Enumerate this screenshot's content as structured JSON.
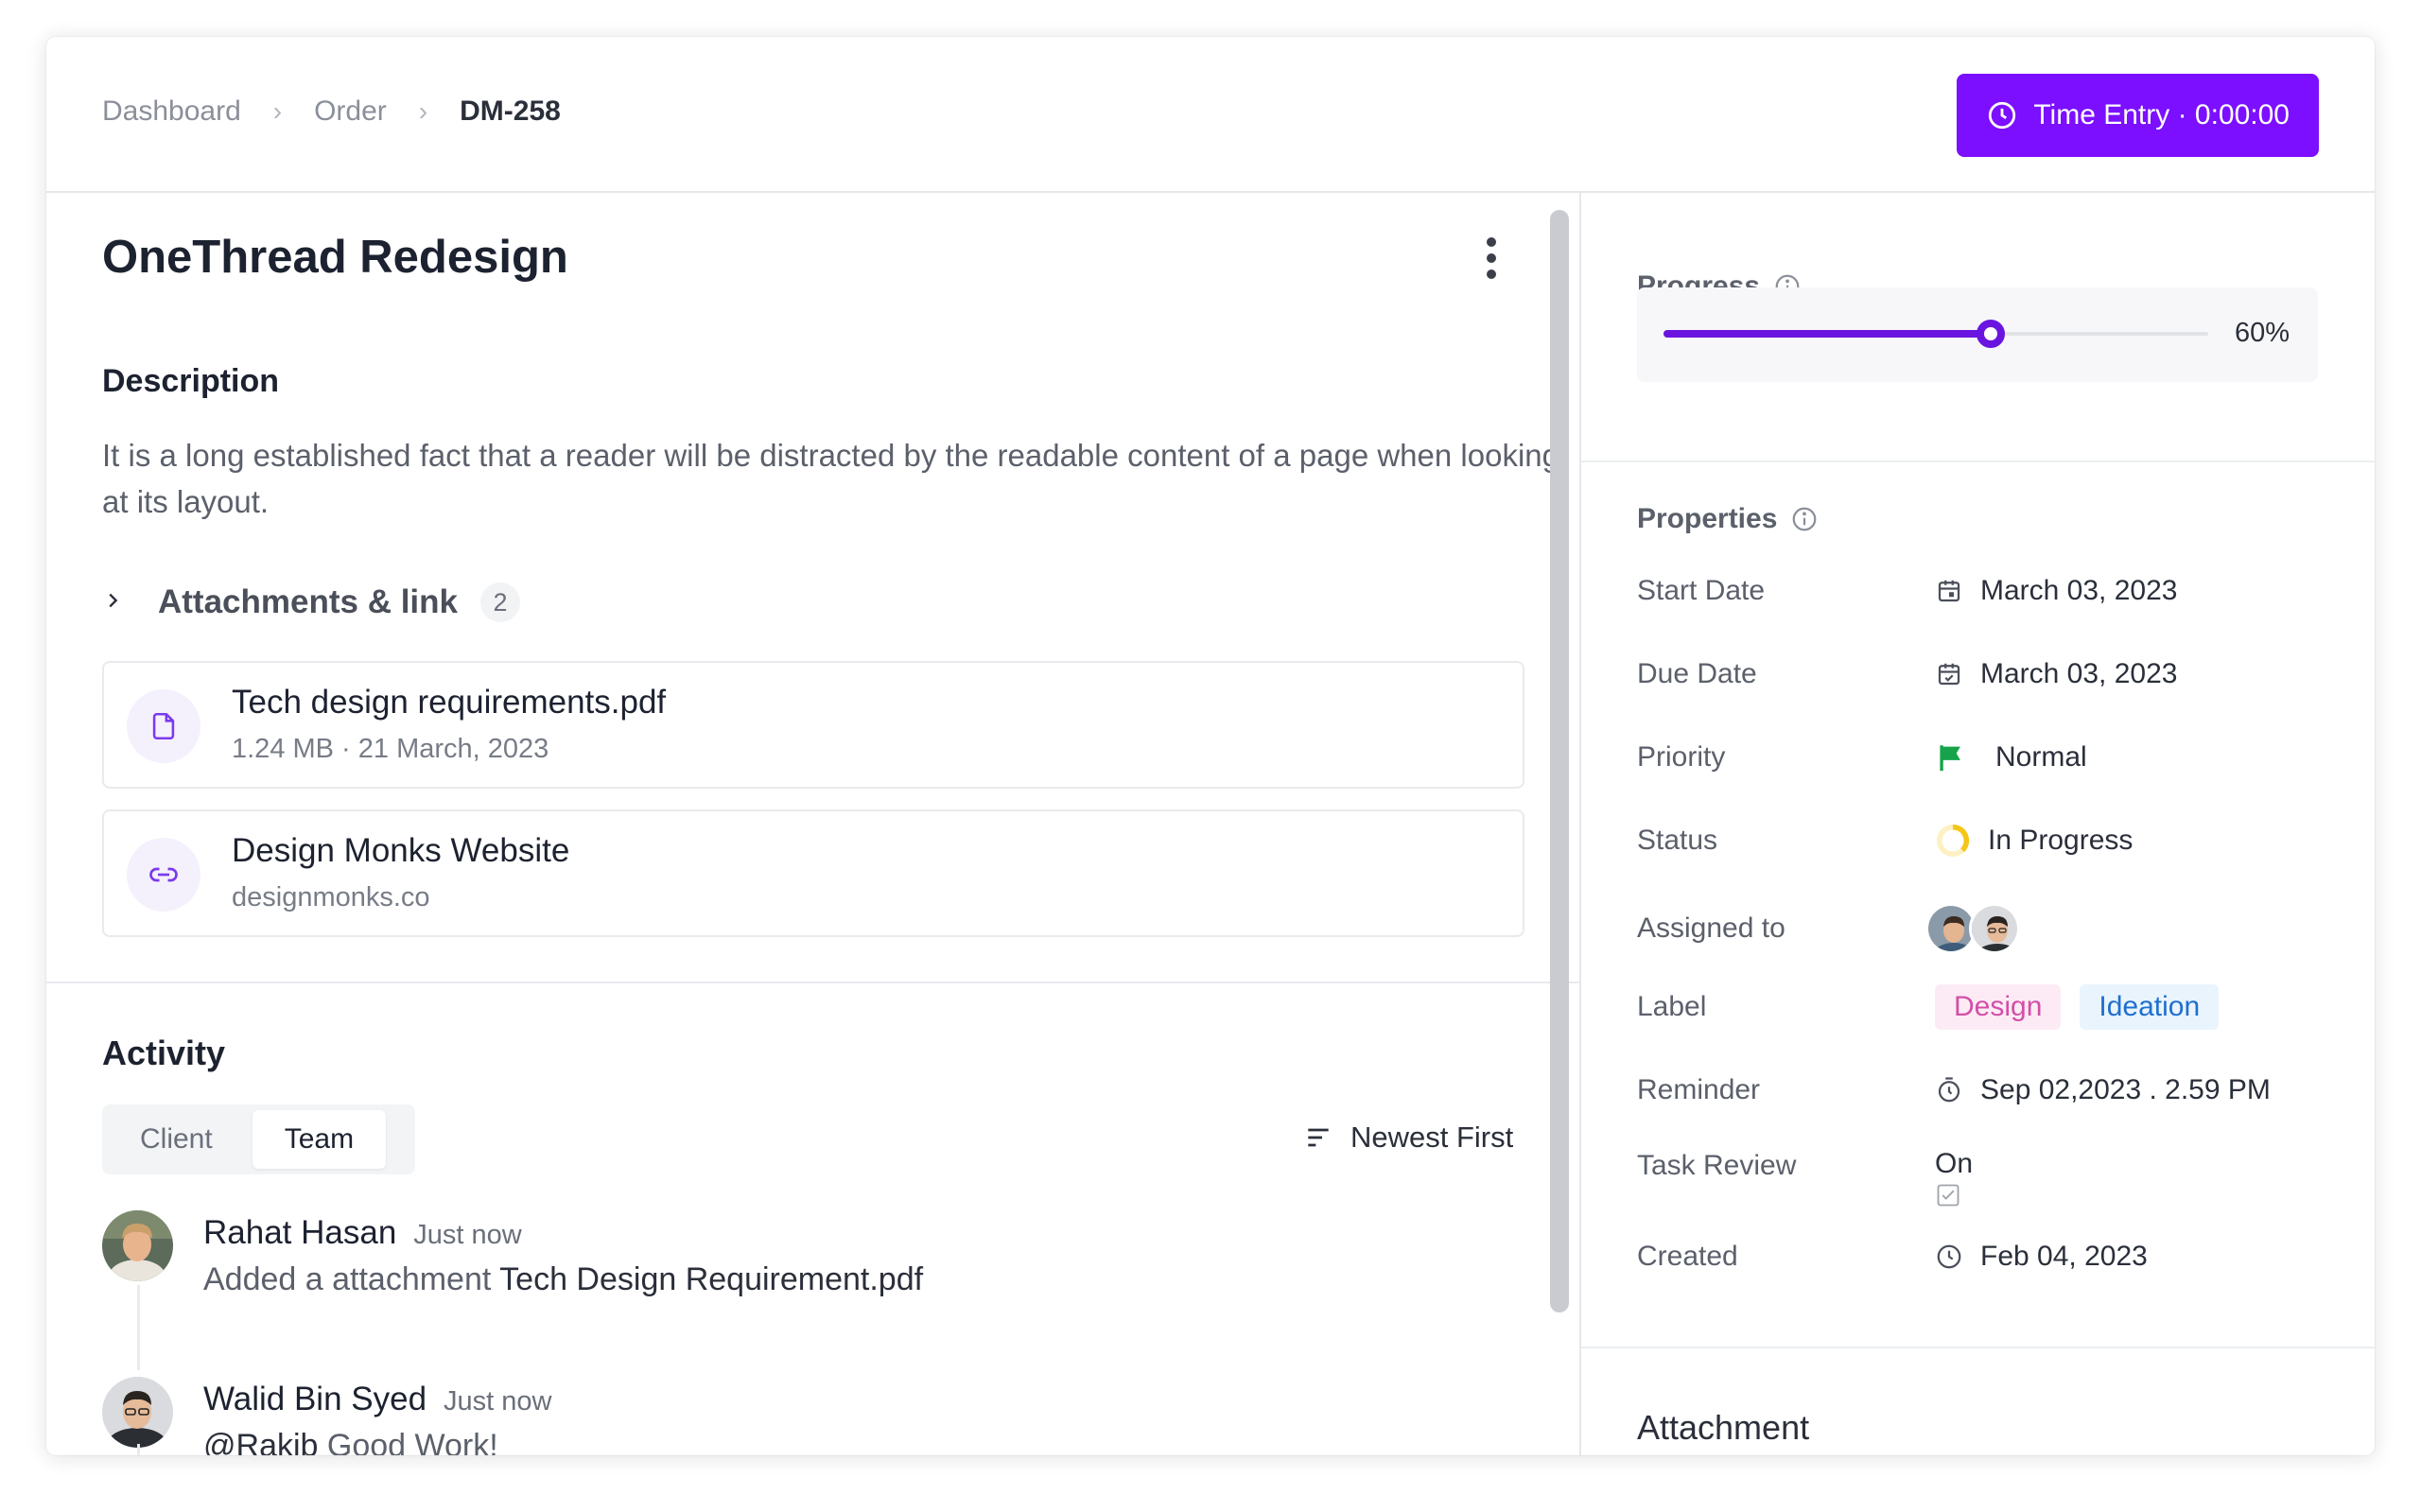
{
  "breadcrumb": {
    "item1": "Dashboard",
    "item2": "Order",
    "current": "DM-258",
    "separator": "›"
  },
  "time_entry": {
    "label": "Time Entry · 0:00:00"
  },
  "task": {
    "title": "OneThread Redesign",
    "description_heading": "Description",
    "description": "It is a long established fact that a reader will be distracted by the readable content of a page when looking at its layout."
  },
  "attachments": {
    "title": "Attachments & link",
    "count": "2",
    "items": [
      {
        "name": "Tech design requirements.pdf",
        "meta": "1.24 MB · 21 March, 2023",
        "icon": "file-icon"
      },
      {
        "name": "Design Monks Website",
        "meta": "designmonks.co",
        "icon": "link-icon"
      }
    ]
  },
  "activity": {
    "heading": "Activity",
    "tabs": [
      {
        "label": "Client",
        "active": false
      },
      {
        "label": "Team",
        "active": true
      }
    ],
    "sort_label": "Newest First",
    "items": [
      {
        "user": "Rahat Hasan",
        "time": "Just now",
        "text_prefix": "Added a attachment ",
        "text_highlight": "Tech Design Requirement.pdf"
      },
      {
        "user": "Walid Bin Syed",
        "time": "Just now",
        "text_prefix": "@Rakib",
        "text_highlight": " Good Work!"
      }
    ]
  },
  "progress": {
    "heading": "Progress",
    "value": 60,
    "label": "60%"
  },
  "properties": {
    "heading": "Properties",
    "start_date": {
      "label": "Start Date",
      "value": "March 03, 2023"
    },
    "due_date": {
      "label": "Due Date",
      "value": "March 03, 2023"
    },
    "priority": {
      "label": "Priority",
      "value": "Normal"
    },
    "status": {
      "label": "Status",
      "value": "In Progress"
    },
    "assigned": {
      "label": "Assigned to"
    },
    "label": {
      "label": "Label",
      "tags": [
        "Design",
        "Ideation"
      ]
    },
    "reminder": {
      "label": "Reminder",
      "value": "Sep 02,2023 . 2.59 PM"
    },
    "task_review": {
      "label": "Task Review",
      "value": "On"
    },
    "created": {
      "label": "Created",
      "value": "Feb 04, 2023"
    }
  },
  "attachment_section": {
    "heading": "Attachment"
  },
  "colors": {
    "accent": "#7c0fff",
    "progress": "#6a14e0",
    "priority_flag": "#16a34a",
    "status_ring": "#f5c518",
    "tag_design": "#d24fa8",
    "tag_ideation": "#1f6fcf"
  }
}
